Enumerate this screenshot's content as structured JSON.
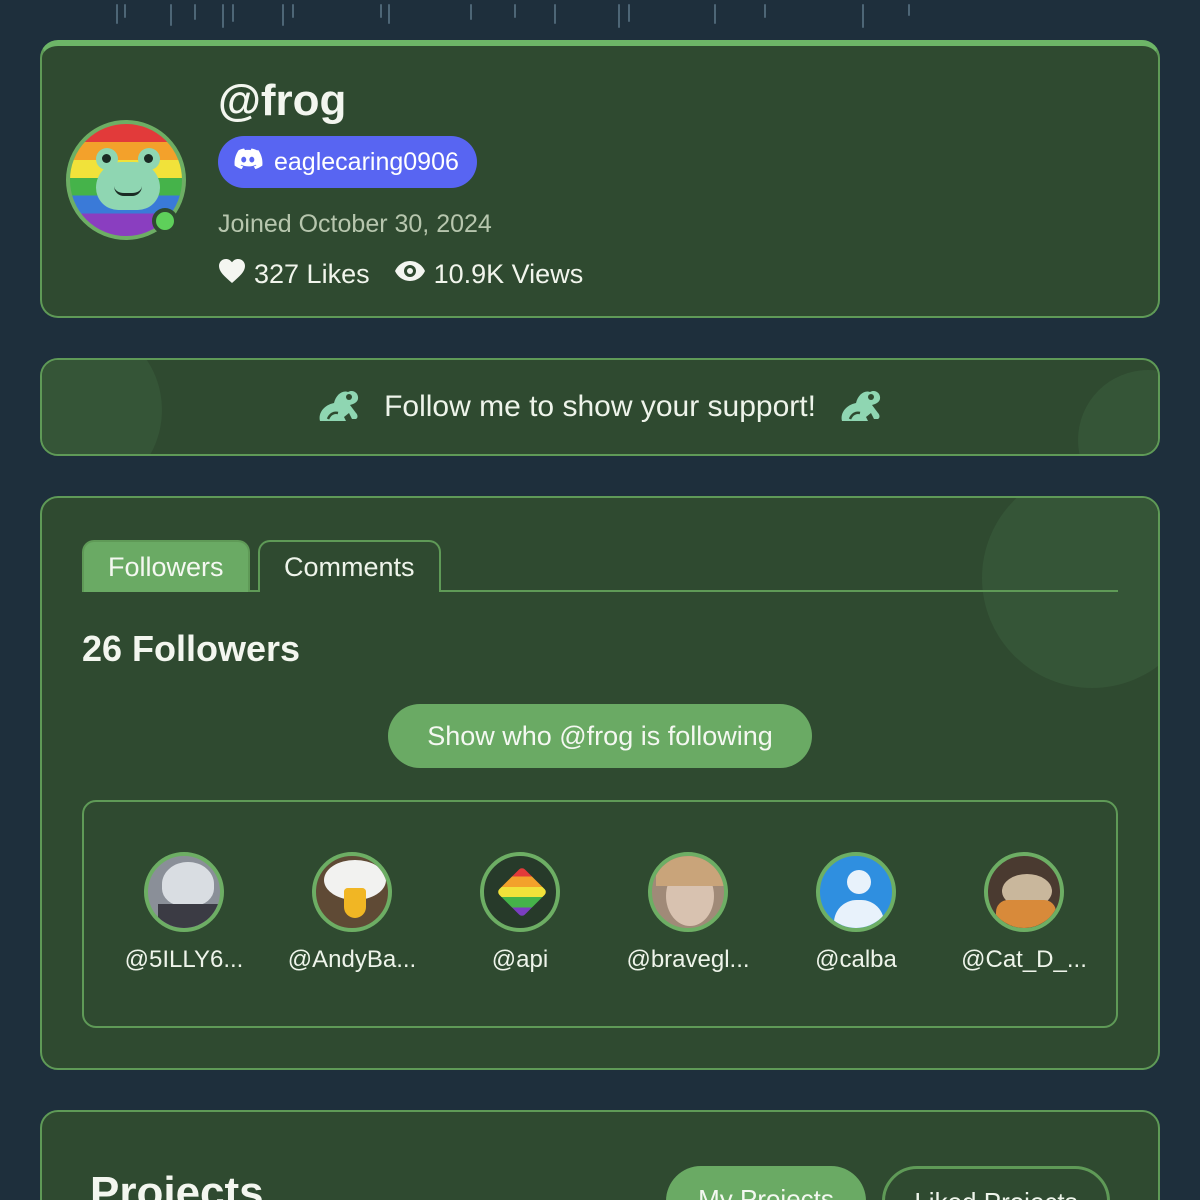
{
  "profile": {
    "username": "@frog",
    "discord_handle": "eaglecaring0906",
    "joined": "Joined October 30, 2024",
    "likes": "327 Likes",
    "views": "10.9K Views",
    "online": true
  },
  "support_banner": {
    "text": "Follow me to show your support!"
  },
  "social_tabs": [
    {
      "label": "Followers",
      "active": true
    },
    {
      "label": "Comments",
      "active": false
    }
  ],
  "followers_section": {
    "heading": "26 Followers",
    "following_button": "Show who @frog is following",
    "followers": [
      {
        "name": "@5ILLY6..."
      },
      {
        "name": "@AndyBa..."
      },
      {
        "name": "@api"
      },
      {
        "name": "@bravegl..."
      },
      {
        "name": "@calba"
      },
      {
        "name": "@Cat_D_..."
      }
    ]
  },
  "projects_section": {
    "title": "Projects",
    "tabs": [
      {
        "label": "My Projects",
        "active": true
      },
      {
        "label": "Liked Projects",
        "active": false
      }
    ]
  },
  "colors": {
    "background": "#1e2f3c",
    "card": "#2f4a30",
    "accent": "#6aaa64",
    "discord": "#5865f2",
    "online": "#5ed05a"
  }
}
